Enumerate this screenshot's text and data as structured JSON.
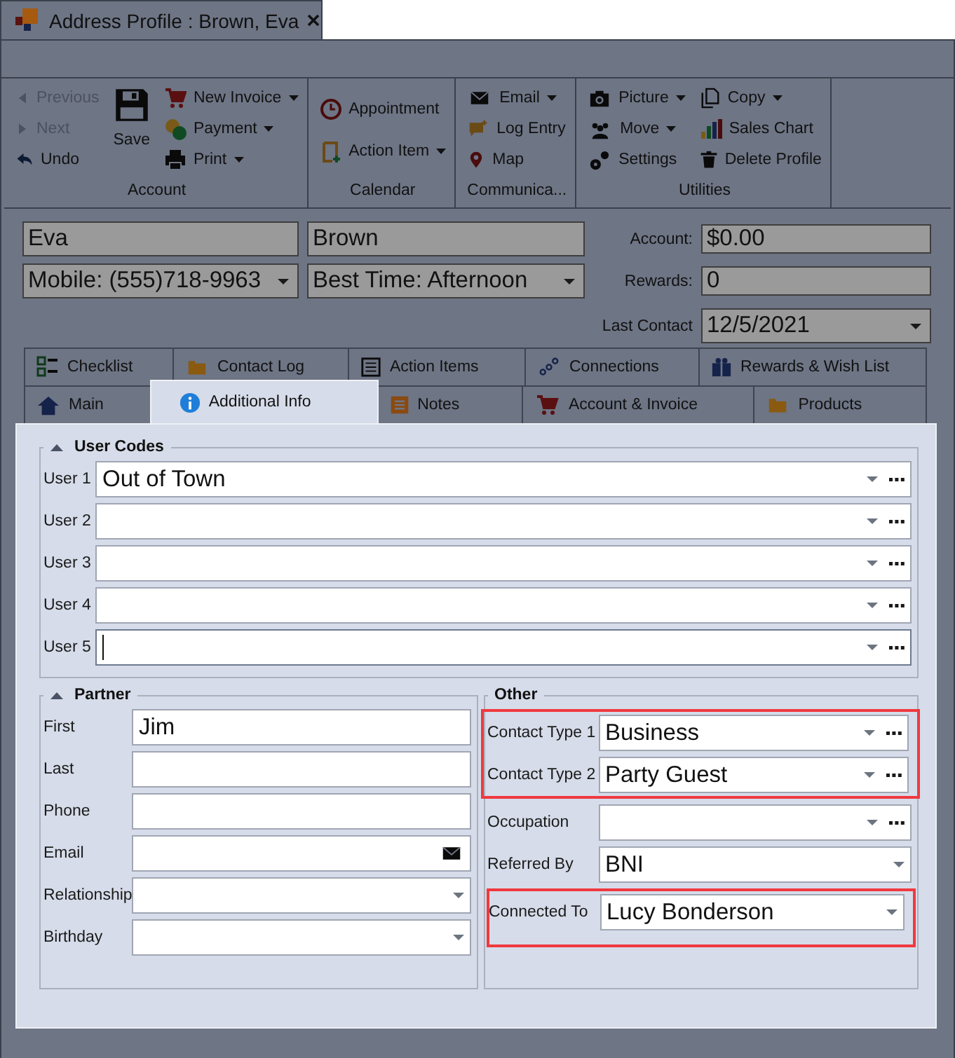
{
  "window": {
    "title": "Address Profile : Brown, Eva"
  },
  "ribbon": {
    "groups": [
      {
        "label": "Account",
        "columns": [
          [
            {
              "label": "Previous",
              "kind": "small",
              "disabled": true,
              "dropdown": false
            },
            {
              "label": "Next",
              "kind": "small",
              "disabled": true,
              "dropdown": false
            },
            {
              "label": "Undo",
              "kind": "small",
              "disabled": false,
              "dropdown": false
            }
          ],
          [
            {
              "label": "Save",
              "kind": "large",
              "disabled": false,
              "dropdown": false
            }
          ],
          [
            {
              "label": "New Invoice",
              "kind": "small",
              "disabled": false,
              "dropdown": true
            },
            {
              "label": "Payment",
              "kind": "small",
              "disabled": false,
              "dropdown": true
            },
            {
              "label": "Print",
              "kind": "small",
              "disabled": false,
              "dropdown": true
            }
          ]
        ]
      },
      {
        "label": "Calendar",
        "columns": [
          [
            {
              "label": "Appointment",
              "kind": "small",
              "disabled": false,
              "dropdown": false
            },
            {
              "label": "Action Item",
              "kind": "small",
              "disabled": false,
              "dropdown": true
            }
          ]
        ]
      },
      {
        "label": "Communica...",
        "columns": [
          [
            {
              "label": "Email",
              "kind": "small",
              "disabled": false,
              "dropdown": true
            },
            {
              "label": "Log Entry",
              "kind": "small",
              "disabled": false,
              "dropdown": false
            },
            {
              "label": "Map",
              "kind": "small",
              "disabled": false,
              "dropdown": false
            }
          ]
        ]
      },
      {
        "label": "Utilities",
        "columns": [
          [
            {
              "label": "Picture",
              "kind": "small",
              "disabled": false,
              "dropdown": true
            },
            {
              "label": "Move",
              "kind": "small",
              "disabled": false,
              "dropdown": true
            },
            {
              "label": "Settings",
              "kind": "small",
              "disabled": false,
              "dropdown": false
            }
          ],
          [
            {
              "label": "Copy",
              "kind": "small",
              "disabled": false,
              "dropdown": true
            },
            {
              "label": "Sales Chart",
              "kind": "small",
              "disabled": false,
              "dropdown": false
            },
            {
              "label": "Delete Profile",
              "kind": "small",
              "disabled": false,
              "dropdown": false
            }
          ]
        ]
      }
    ]
  },
  "header": {
    "fields": [
      {
        "value": "Eva",
        "kind": "text"
      },
      {
        "value": "Brown",
        "kind": "text"
      },
      {
        "value": "Mobile: (555)718-9963",
        "kind": "combo"
      },
      {
        "value": "Best Time: Afternoon",
        "kind": "combo"
      }
    ],
    "summary": [
      {
        "label": "Account:",
        "value": "$0.00",
        "kind": "text"
      },
      {
        "label": "Rewards:",
        "value": "0",
        "kind": "text"
      },
      {
        "label": "Last Contact",
        "value": "12/5/2021",
        "kind": "combo"
      }
    ]
  },
  "tabs": [
    [
      {
        "label": "Checklist",
        "selected": false
      },
      {
        "label": "Contact Log",
        "selected": false
      },
      {
        "label": "Action Items",
        "selected": false
      },
      {
        "label": "Connections",
        "selected": false
      },
      {
        "label": "Rewards & Wish List",
        "selected": false
      }
    ],
    [
      {
        "label": "Main",
        "selected": false
      },
      {
        "label": "Additional Info",
        "selected": true
      },
      {
        "label": "Notes",
        "selected": false
      },
      {
        "label": "Account & Invoice",
        "selected": false
      },
      {
        "label": "Products",
        "selected": false
      }
    ]
  ],
  "user_codes": {
    "title": "User Codes",
    "collapsible": true,
    "fields": [
      {
        "label": "User 1",
        "value": "Out of Town",
        "kind": "combo-more",
        "focused": false
      },
      {
        "label": "User 2",
        "kind": "combo-more",
        "focused": false
      },
      {
        "label": "User 3",
        "kind": "combo-more",
        "focused": false
      },
      {
        "label": "User 4",
        "kind": "combo-more",
        "focused": false
      },
      {
        "label": "User 5",
        "kind": "combo-more",
        "focused": true
      }
    ]
  },
  "partner": {
    "title": "Partner",
    "collapsible": true,
    "fields": [
      {
        "label": "First",
        "value": "Jim",
        "kind": "text"
      },
      {
        "label": "Last",
        "kind": "text"
      },
      {
        "label": "Phone",
        "kind": "text"
      },
      {
        "label": "Email",
        "kind": "email"
      },
      {
        "label": "Relationship",
        "kind": "combo"
      },
      {
        "label": "Birthday",
        "kind": "combo"
      }
    ]
  },
  "other": {
    "title": "Other",
    "collapsible": false,
    "fields": [
      {
        "label": "Contact Type 1",
        "value": "Business",
        "kind": "combo-more",
        "highlighted": true
      },
      {
        "label": "Contact Type 2",
        "value": "Party Guest",
        "kind": "combo-more",
        "highlighted": true
      },
      {
        "label": "Occupation",
        "kind": "combo-more",
        "highlighted": false
      },
      {
        "label": "Referred By",
        "value": "BNI",
        "kind": "combo",
        "highlighted": false
      },
      {
        "label": "Connected To",
        "value": "Lucy Bonderson",
        "kind": "combo",
        "highlighted": true
      }
    ]
  }
}
